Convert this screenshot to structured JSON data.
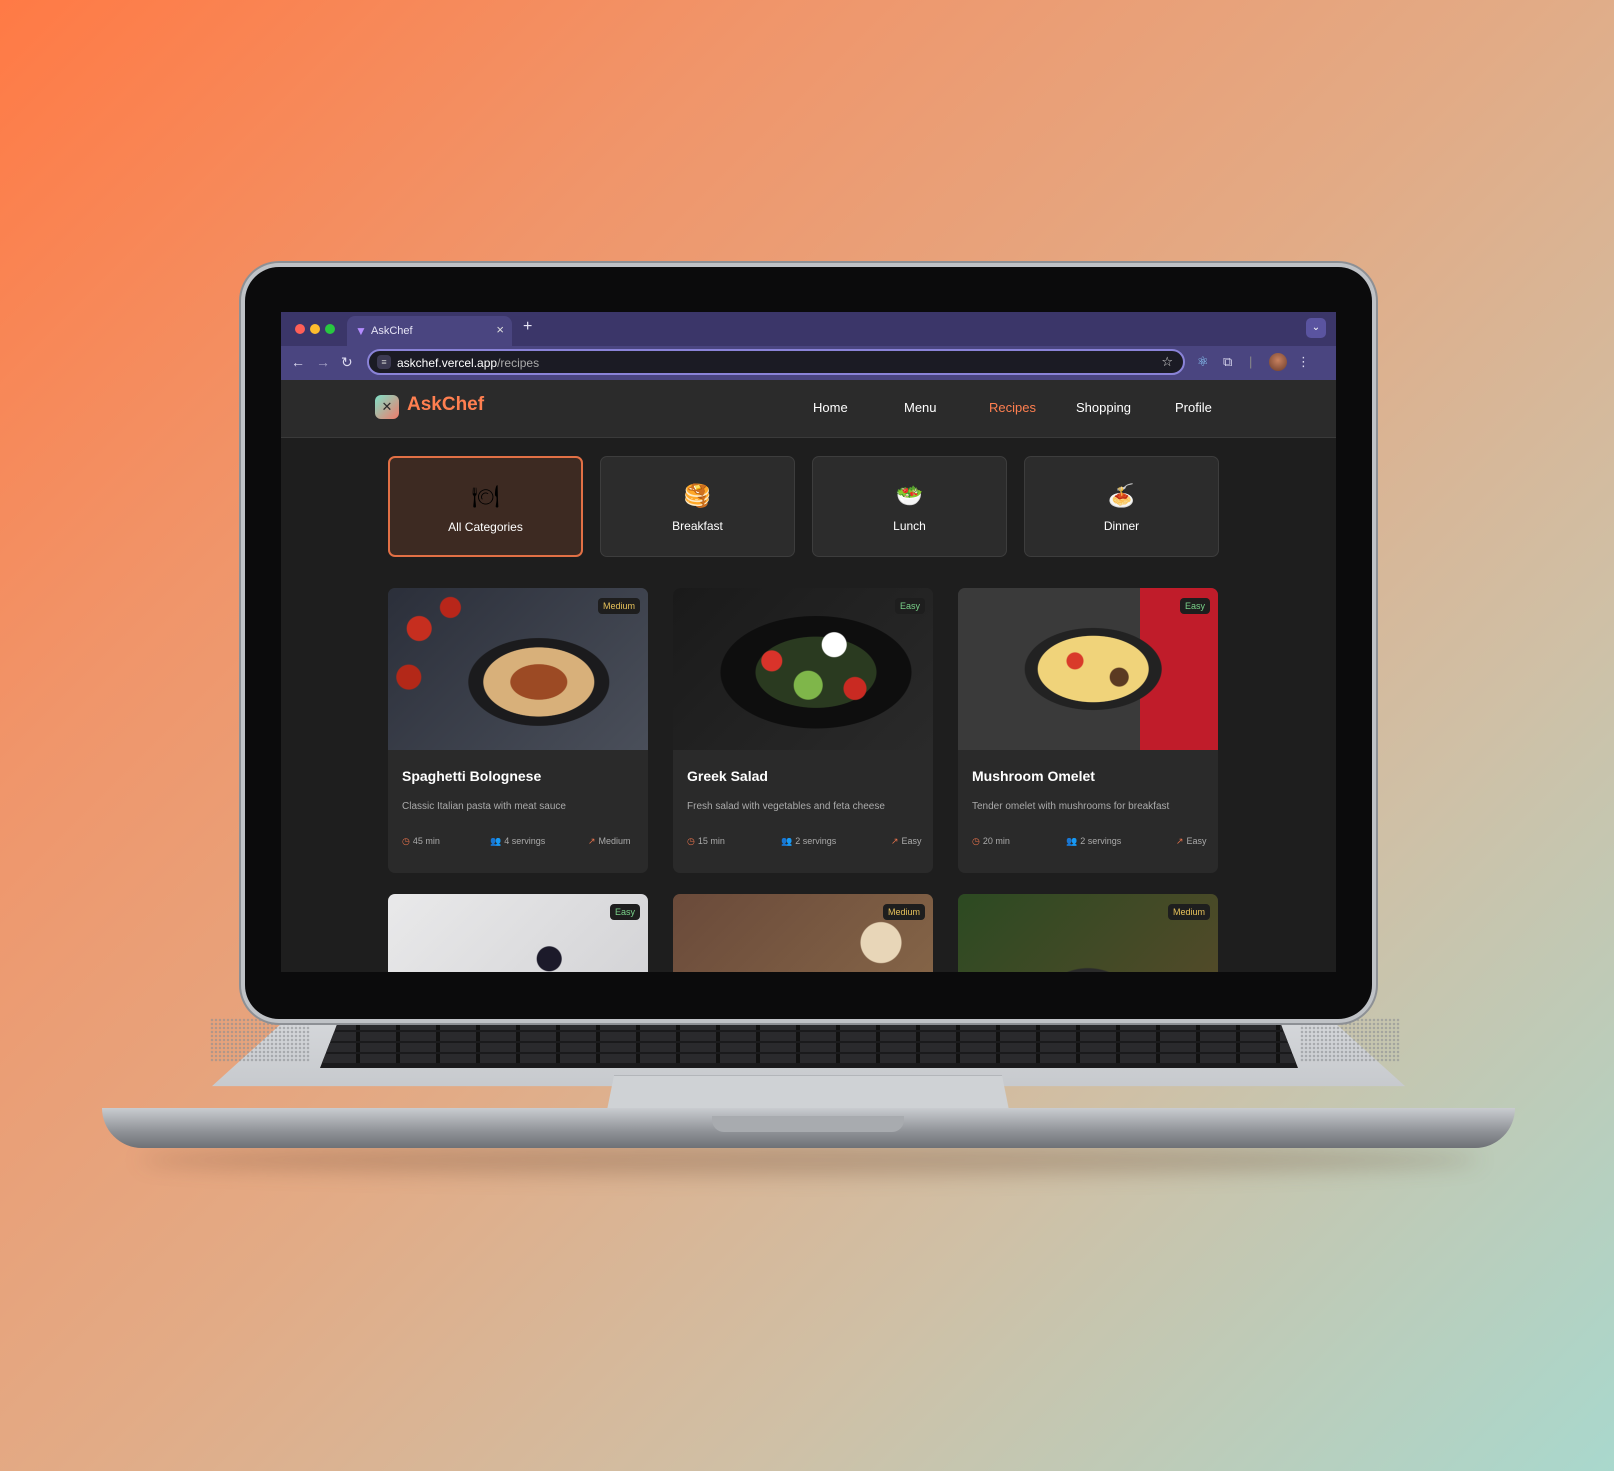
{
  "browser": {
    "tab_title": "AskChef",
    "url_host": "askchef.vercel.app",
    "url_path": "/recipes"
  },
  "app": {
    "brand": "AskChef",
    "nav": [
      "Home",
      "Menu",
      "Recipes",
      "Shopping",
      "Profile"
    ],
    "active_nav": "Recipes",
    "accent_color": "#ff7f50"
  },
  "categories": [
    {
      "label": "All Categories",
      "icon": "plate-icon",
      "active": true
    },
    {
      "label": "Breakfast",
      "icon": "pancakes-icon",
      "active": false
    },
    {
      "label": "Lunch",
      "icon": "salad-icon",
      "active": false
    },
    {
      "label": "Dinner",
      "icon": "spaghetti-icon",
      "active": false
    }
  ],
  "recipes": [
    {
      "title": "Spaghetti Bolognese",
      "description": "Classic Italian pasta with meat sauce",
      "time": "45 min",
      "servings": "4 servings",
      "difficulty": "Medium",
      "badge": "Medium"
    },
    {
      "title": "Greek Salad",
      "description": "Fresh salad with vegetables and feta cheese",
      "time": "15 min",
      "servings": "2 servings",
      "difficulty": "Easy",
      "badge": "Easy"
    },
    {
      "title": "Mushroom Omelet",
      "description": "Tender omelet with mushrooms for breakfast",
      "time": "20 min",
      "servings": "2 servings",
      "difficulty": "Easy",
      "badge": "Easy"
    },
    {
      "badge": "Easy"
    },
    {
      "badge": "Medium"
    },
    {
      "badge": "Medium"
    }
  ]
}
